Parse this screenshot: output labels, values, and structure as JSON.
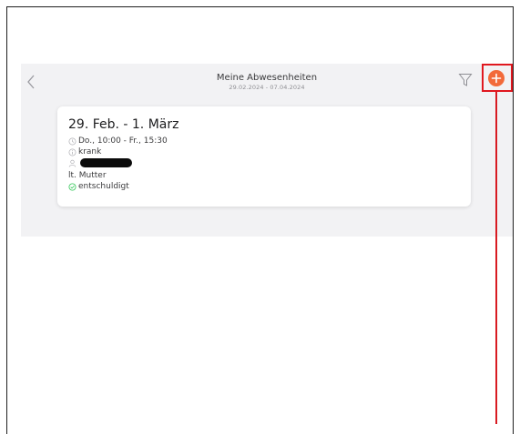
{
  "header": {
    "title": "Meine Abwesenheiten",
    "date_range": "29.02.2024 - 07.04.2024"
  },
  "absence": {
    "title": "29. Feb. - 1. März",
    "time": "Do., 10:00 - Fr., 15:30",
    "reason": "krank",
    "note": "lt. Mutter",
    "status": "entschuldigt"
  },
  "icons": {
    "back": "chevron-left-icon",
    "filter": "filter-icon",
    "add": "plus-circle-icon",
    "time": "clock-icon",
    "reason": "info-icon",
    "person": "person-icon",
    "status": "check-circle-icon"
  },
  "colors": {
    "accent": "#f26a3a",
    "status_ok": "#34c759",
    "annotation": "#e0181f"
  }
}
